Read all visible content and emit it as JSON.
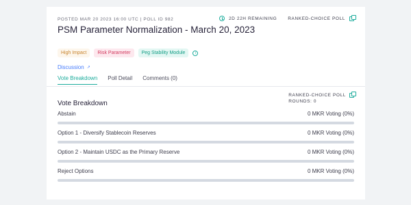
{
  "header": {
    "meta": "POSTED MAR 20 2023 16:00 UTC | POLL ID 982",
    "remaining": "2D 22H REMAINING",
    "poll_type": "RANKED-CHOICE POLL",
    "title": "PSM Parameter Normalization - March 20, 2023"
  },
  "tags": [
    "High Impact",
    "Risk Parameter",
    "Peg Stability Module"
  ],
  "discussion_label": "Discussion",
  "tabs": [
    "Vote Breakdown",
    "Poll Detail",
    "Comments (0)"
  ],
  "active_tab": "Vote Breakdown",
  "breakdown": {
    "title": "Vote Breakdown",
    "poll_type": "RANKED-CHOICE POLL",
    "rounds": "ROUNDS: 0",
    "options": [
      {
        "label": "Abstain",
        "value": "0 MKR Voting (0%)",
        "percent": 0
      },
      {
        "label": "Option 1 - Diversify Stablecoin Reserves",
        "value": "0 MKR Voting (0%)",
        "percent": 0
      },
      {
        "label": "Option 2 - Maintain USDC as the Primary Reserve",
        "value": "0 MKR Voting (0%)",
        "percent": 0
      },
      {
        "label": "Reject Options",
        "value": "0 MKR Voting (0%)",
        "percent": 0
      }
    ]
  },
  "colors": {
    "accent": "#1aab9b",
    "link": "#447afc",
    "bar_track": "#d4d9e1"
  }
}
